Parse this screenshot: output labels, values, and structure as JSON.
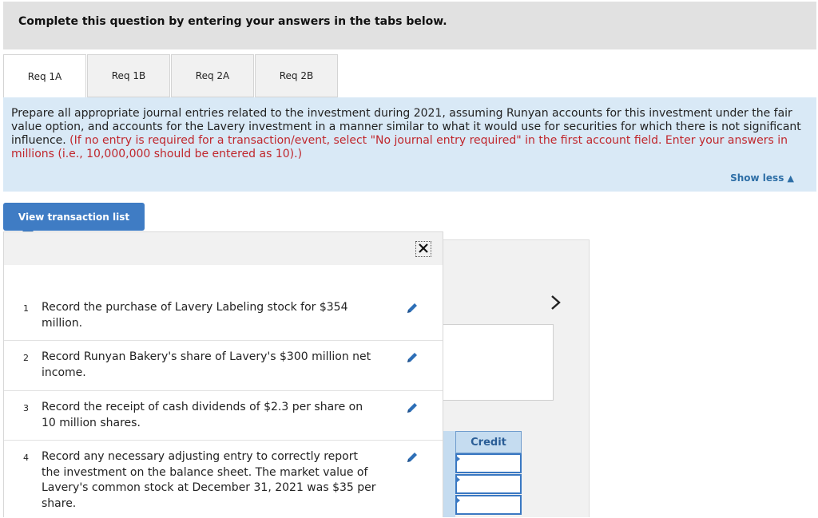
{
  "banner": {
    "text": "Complete this question by entering your answers in the tabs below."
  },
  "tabs": [
    {
      "label": "Req 1A",
      "active": true
    },
    {
      "label": "Req 1B",
      "active": false
    },
    {
      "label": "Req 2A",
      "active": false
    },
    {
      "label": "Req 2B",
      "active": false
    }
  ],
  "instructions": {
    "main": "Prepare all appropriate journal entries related to the investment during 2021, assuming Runyan accounts for this investment under the fair value option, and accounts for the Lavery investment in a manner similar to what it would use for securities for which there is not significant influence.",
    "note": "(If no entry is required for a transaction/event, select \"No journal entry required\" in the first account field. Enter your answers in millions (i.e., 10,000,000 should be entered as 10).)",
    "show_less": "Show less"
  },
  "view_button": {
    "label": "View transaction list"
  },
  "transactions": [
    {
      "num": "1",
      "text": "Record the purchase of Lavery Labeling stock for $354 million."
    },
    {
      "num": "2",
      "text": "Record Runyan Bakery's share of Lavery's $300 million net income."
    },
    {
      "num": "3",
      "text": "Record the receipt of cash dividends of $2.3 per share on 10 million shares."
    },
    {
      "num": "4",
      "text": "Record any necessary adjusting entry to correctly report the investment on the balance sheet. The market value of Lavery's common stock at December 31, 2021 was $35 per share."
    }
  ],
  "journal": {
    "credit_label": "Credit"
  },
  "icons": {
    "close": "close-icon",
    "edit": "pencil-icon",
    "next": "chevron-right-icon",
    "show_less": "triangle-up-icon"
  },
  "colors": {
    "banner_bg": "#e1e1e1",
    "instructions_bg": "#d9e9f6",
    "note_red": "#c0272d",
    "button_blue": "#3f7cc4",
    "link_blue": "#2d6ea6"
  }
}
